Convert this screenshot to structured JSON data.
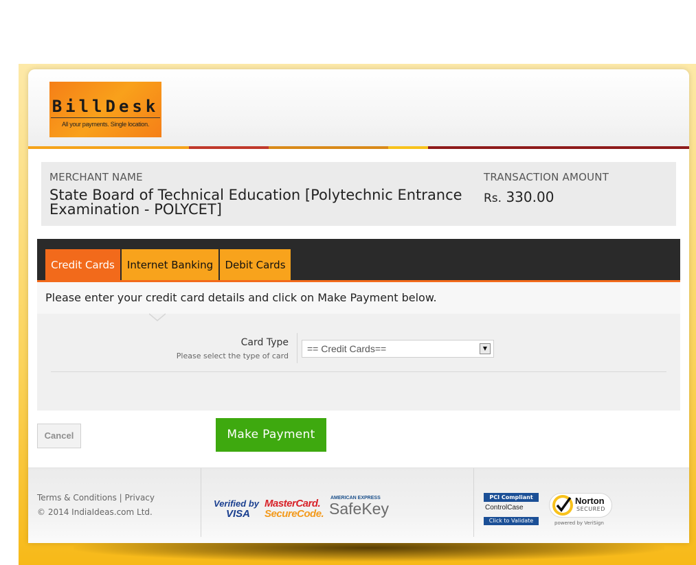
{
  "header": {
    "logo_name": "BillDesk",
    "logo_tagline": "All your payments. Single location."
  },
  "merchant": {
    "name_label": "MERCHANT NAME",
    "name": "State Board of Technical Education [Polytechnic Entrance Examination - POLYCET]",
    "amount_label": "TRANSACTION AMOUNT",
    "currency": "Rs.",
    "amount": "330.00"
  },
  "tabs": [
    {
      "label": "Credit Cards",
      "active": true
    },
    {
      "label": "Internet Banking",
      "active": false
    },
    {
      "label": "Debit Cards",
      "active": false
    }
  ],
  "form": {
    "instruction": "Please enter your credit card details and click on Make Payment below.",
    "card_type_label": "Card Type",
    "card_type_hint": "Please select the type of card",
    "card_type_value": "== Credit Cards=="
  },
  "actions": {
    "cancel_label": "Cancel",
    "pay_label": "Make Payment"
  },
  "footer": {
    "terms_label": "Terms & Conditions",
    "separator": "|",
    "privacy_label": "Privacy",
    "copyright": "© 2014 IndiaIdeas.com Ltd.",
    "badges": {
      "visa_top": "Verified by",
      "visa_bottom": "VISA",
      "mc_top": "MasterCard.",
      "mc_bottom": "SecureCode.",
      "amex_top": "AMERICAN EXPRESS",
      "amex_bottom": "SafeKey",
      "pci_top": "PCI Compliant",
      "pci_mid": "ControlCase",
      "pci_bottom": "Click to Validate",
      "norton_top": "Norton",
      "norton_mid": "SECURED",
      "norton_bottom": "powered by VeriSign"
    }
  },
  "colors": {
    "accent_orange": "#f26a1b",
    "tab_orange": "#f8a31c",
    "pay_green": "#3ea90f",
    "tabbar_dark": "#2a2a2a",
    "frame_yellow": "#fbd35a"
  }
}
